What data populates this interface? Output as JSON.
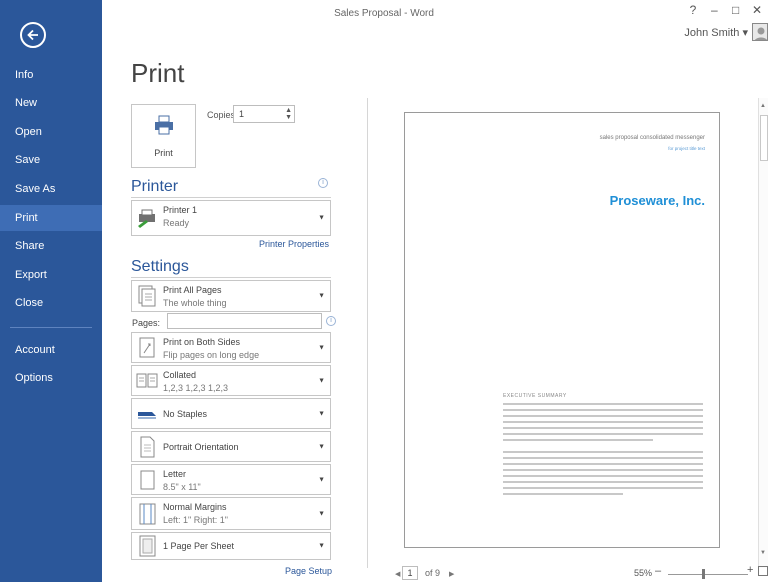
{
  "window": {
    "title": "Sales Proposal - Word",
    "help": "?",
    "minimize": "–",
    "restore": "□",
    "close": "✕",
    "user_name": "John Smith",
    "user_menu": "▾"
  },
  "nav": {
    "items": [
      {
        "label": "Info"
      },
      {
        "label": "New"
      },
      {
        "label": "Open"
      },
      {
        "label": "Save"
      },
      {
        "label": "Save As"
      },
      {
        "label": "Print"
      },
      {
        "label": "Share"
      },
      {
        "label": "Export"
      },
      {
        "label": "Close"
      },
      {
        "label": "Account"
      },
      {
        "label": "Options"
      }
    ],
    "active": "Print"
  },
  "print": {
    "title": "Print",
    "button_label": "Print",
    "copies_label": "Copies:",
    "copies_value": "1"
  },
  "printer": {
    "section_title": "Printer",
    "info_icon": "i",
    "name": "Printer 1",
    "status": "Ready",
    "properties_link": "Printer Properties"
  },
  "settings": {
    "section_title": "Settings",
    "print_range": {
      "line1": "Print All Pages",
      "line2": "The whole thing"
    },
    "pages_label": "Pages:",
    "pages_value": "",
    "pages_info_icon": "i",
    "sides": {
      "line1": "Print on Both Sides",
      "line2": "Flip pages on long edge"
    },
    "collation": {
      "line1": "Collated",
      "line2": "1,2,3   1,2,3   1,2,3"
    },
    "staples": "No Staples",
    "orientation": "Portrait Orientation",
    "paper": {
      "line1": "Letter",
      "line2": "8.5\" x 11\""
    },
    "margins": {
      "line1": "Normal Margins",
      "line2": "Left: 1\"   Right: 1\""
    },
    "pages_per_sheet": "1 Page Per Sheet",
    "page_setup_link": "Page Setup",
    "arrow": "▼"
  },
  "preview": {
    "header_text": "sales proposal  consolidated messenger",
    "header_sub": "for project title text",
    "company": "Proseware, Inc.",
    "summary_heading": "EXECUTIVE SUMMARY",
    "current_page": "1",
    "page_of": "of 9",
    "prev": "◀",
    "next": "▶",
    "zoom": "55%",
    "zoom_minus": "–",
    "zoom_plus": "+",
    "scroll_up": "▲",
    "scroll_down": "▼"
  }
}
